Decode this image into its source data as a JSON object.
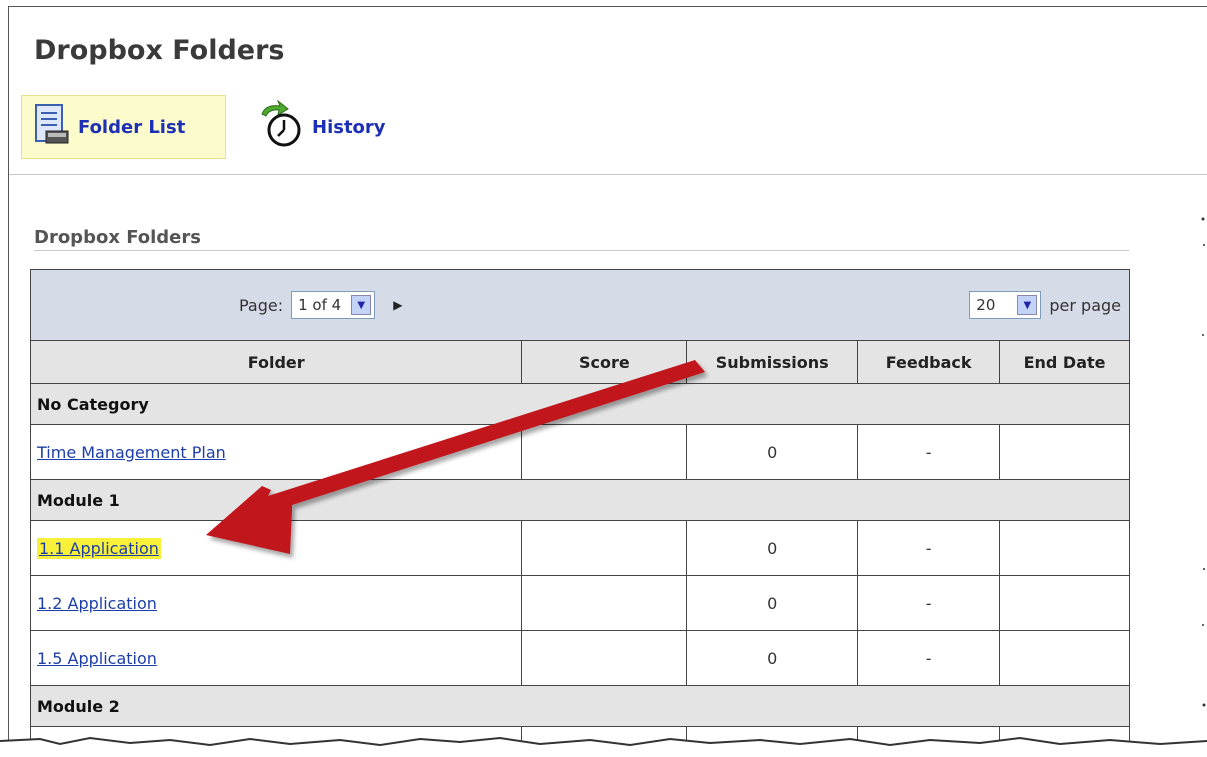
{
  "page": {
    "title": "Dropbox Folders"
  },
  "tabs": [
    {
      "label": "Folder List",
      "icon": "folder-list-icon",
      "active": true
    },
    {
      "label": "History",
      "icon": "history-clock-icon",
      "active": false
    }
  ],
  "section": {
    "title": "Dropbox Folders"
  },
  "pager": {
    "page_label": "Page:",
    "page_value": "1 of 4",
    "per_page_value": "20",
    "per_page_label": "per page"
  },
  "columns": [
    "Folder",
    "Score",
    "Submissions",
    "Feedback",
    "End Date"
  ],
  "groups": [
    {
      "category": "No Category",
      "rows": [
        {
          "folder": "Time Management Plan",
          "score": "",
          "submissions": "0",
          "feedback": "-",
          "end_date": ""
        }
      ]
    },
    {
      "category": "Module 1",
      "rows": [
        {
          "folder": "1.1 Application",
          "score": "",
          "submissions": "0",
          "feedback": "-",
          "end_date": "",
          "highlighted": true
        },
        {
          "folder": "1.2 Application",
          "score": "",
          "submissions": "0",
          "feedback": "-",
          "end_date": ""
        },
        {
          "folder": "1.5 Application",
          "score": "",
          "submissions": "0",
          "feedback": "-",
          "end_date": ""
        }
      ]
    },
    {
      "category": "Module 2",
      "rows": []
    }
  ],
  "colors": {
    "link": "#1c3ea8",
    "highlight": "#f9f03a",
    "active_tab_bg": "#fbfbcb",
    "pager_bg": "#d6dbe8",
    "header_bg": "#e4e4e4",
    "annotation_arrow": "#c0141b"
  }
}
